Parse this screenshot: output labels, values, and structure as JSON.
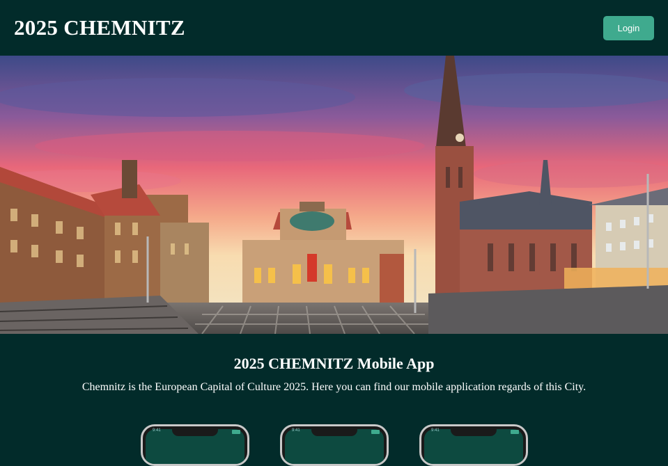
{
  "header": {
    "brand": "2025 CHEMNITZ",
    "login_label": "Login"
  },
  "hero": {
    "image_alt": "Chemnitz theatre square at sunset"
  },
  "content": {
    "title": "2025 CHEMNITZ Mobile App",
    "description": "Chemnitz is the European Capital of Culture 2025. Here you can find our mobile application regards of this City."
  },
  "phones": [
    {
      "time": "9:41"
    },
    {
      "time": "9:41"
    },
    {
      "time": "9:41"
    }
  ],
  "colors": {
    "background": "#022b2a",
    "accent": "#3faa8e"
  }
}
